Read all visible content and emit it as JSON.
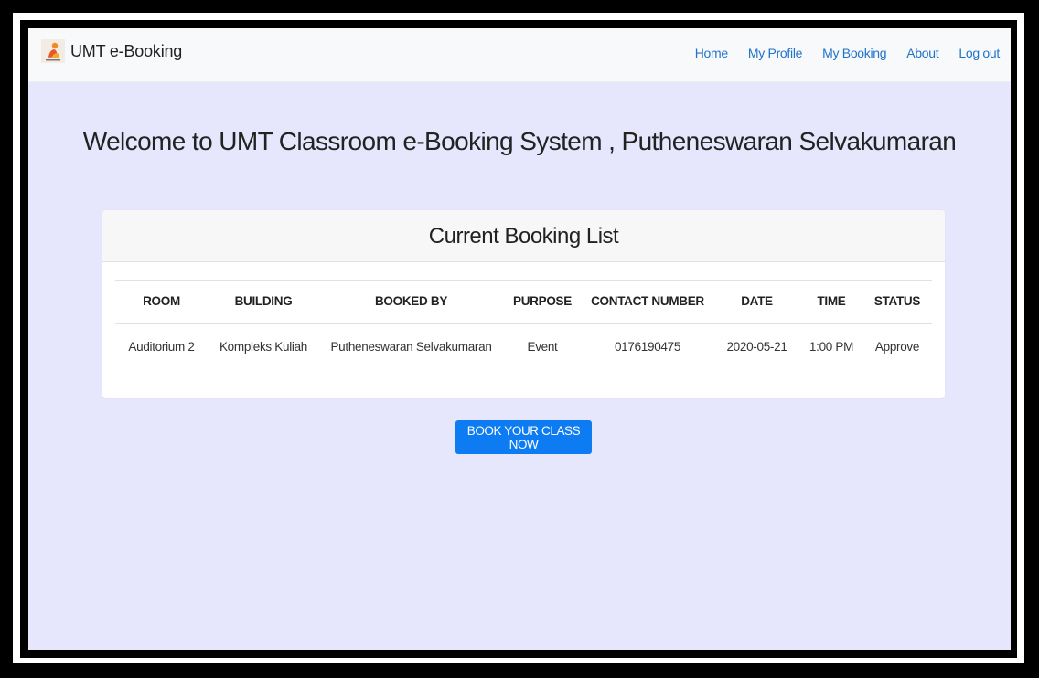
{
  "navbar": {
    "brand": "UMT e-Booking",
    "links": [
      "Home",
      "My Profile",
      "My Booking",
      "About",
      "Log out"
    ]
  },
  "welcome": "Welcome to UMT Classroom e-Booking System , Putheneswaran Selvakumaran",
  "booking_list": {
    "title": "Current Booking List",
    "columns": [
      "ROOM",
      "BUILDING",
      "BOOKED BY",
      "PURPOSE",
      "CONTACT NUMBER",
      "DATE",
      "TIME",
      "STATUS"
    ],
    "rows": [
      [
        "Auditorium 2",
        "Kompleks Kuliah",
        "Putheneswaran Selvakumaran",
        "Event",
        "0176190475",
        "2020-05-21",
        "1:00 PM",
        "Approve"
      ]
    ]
  },
  "book_button": "BOOK YOUR CLASS NOW",
  "colors": {
    "page_background": "#e6e6fc",
    "navbar_background": "#f8f9fa",
    "link": "#1f73c8",
    "primary_button": "#0d7cf2"
  }
}
